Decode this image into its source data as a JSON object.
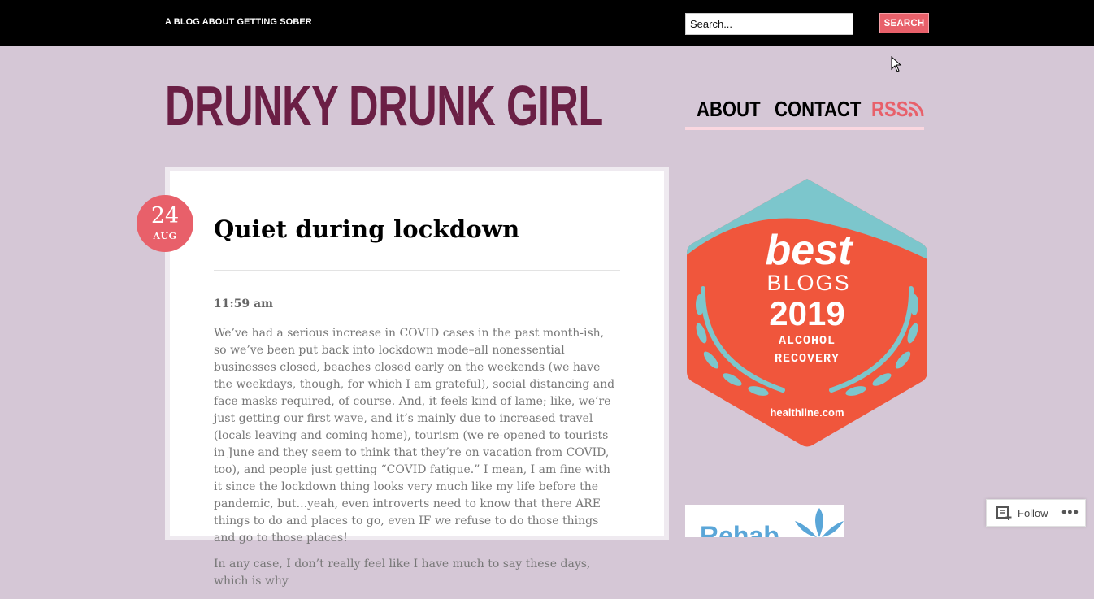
{
  "header": {
    "tagline": "A BLOG ABOUT GETTING SOBER",
    "search_placeholder": "Search...",
    "search_button": "SEARCH"
  },
  "site": {
    "title": "DRUNKY DRUNK GIRL"
  },
  "nav": {
    "items": [
      {
        "label": "ABOUT"
      },
      {
        "label": "CONTACT"
      },
      {
        "label": "RSS"
      }
    ]
  },
  "post": {
    "date_day": "24",
    "date_month": "AUG",
    "title": "Quiet during lockdown",
    "time": "11:59 am",
    "paragraphs": [
      "We’ve had a serious increase in COVID cases in the past month-ish, so we’ve been put back into lockdown mode–all nonessential businesses closed, beaches closed early on the weekends (we have the weekdays, though, for which I am grateful), social distancing and face masks required, of course. And, it feels kind of lame; like, we’re just getting our first wave, and it’s mainly due to increased travel (locals leaving and coming home), tourism (we re-opened to tourists in June and they seem to think that they’re on vacation from COVID, too), and people just getting “COVID fatigue.” I mean, I am fine with it since the lockdown thing looks very much like my life before the pandemic, but...yeah, even introverts need to know that there ARE things to do and places to go, even IF we refuse to do those things and go to those places!",
      "In any case, I don’t really feel like I have much to say these days, which is why"
    ]
  },
  "sidebar": {
    "badge": {
      "line1": "best",
      "line2": "BLOGS",
      "year": "2019",
      "category1": "ALCOHOL",
      "category2": "RECOVERY",
      "site": "healthline.com"
    },
    "rehab_text": "Rehab"
  },
  "follow": {
    "label": "Follow",
    "more": "•••"
  },
  "colors": {
    "background": "#d5c7d6",
    "title": "#6b1f45",
    "accent": "#e8606a",
    "badge_orange": "#f0563c",
    "badge_teal": "#7cc6cc"
  }
}
